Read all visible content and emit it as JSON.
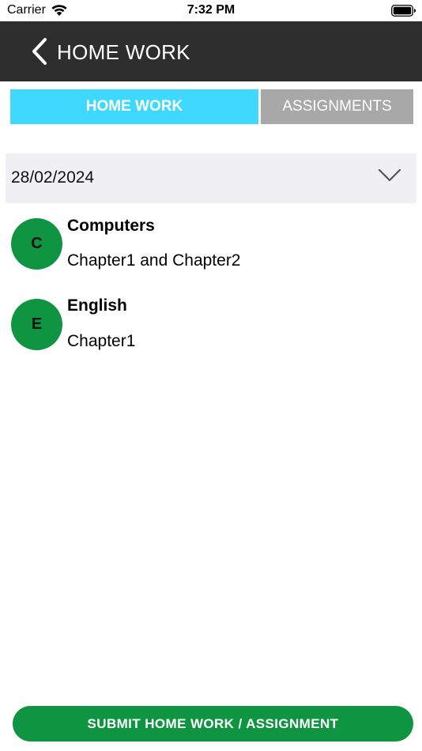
{
  "status_bar": {
    "carrier": "Carrier",
    "time": "7:32 PM",
    "icons": [
      "wifi-icon",
      "battery-icon"
    ]
  },
  "nav": {
    "title": "HOME WORK",
    "back_icon": "chevron-left-icon"
  },
  "tabs": [
    {
      "label": "HOME WORK",
      "active": true
    },
    {
      "label": "ASSIGNMENTS",
      "active": false
    }
  ],
  "date_select": {
    "value": "28/02/2024",
    "icon": "chevron-down-icon"
  },
  "homework_items": [
    {
      "initial": "C",
      "subject": "Computers",
      "detail": "Chapter1 and Chapter2"
    },
    {
      "initial": "E",
      "subject": "English",
      "detail": "Chapter1"
    }
  ],
  "submit_label": "SUBMIT HOME WORK / ASSIGNMENT",
  "colors": {
    "nav_bg": "#2e2e2e",
    "tab_active": "#3fd9ff",
    "tab_inactive": "#a8a8a8",
    "select_bg": "#efeff4",
    "avatar_green": "#0f9441",
    "submit_green": "#0f9441"
  }
}
